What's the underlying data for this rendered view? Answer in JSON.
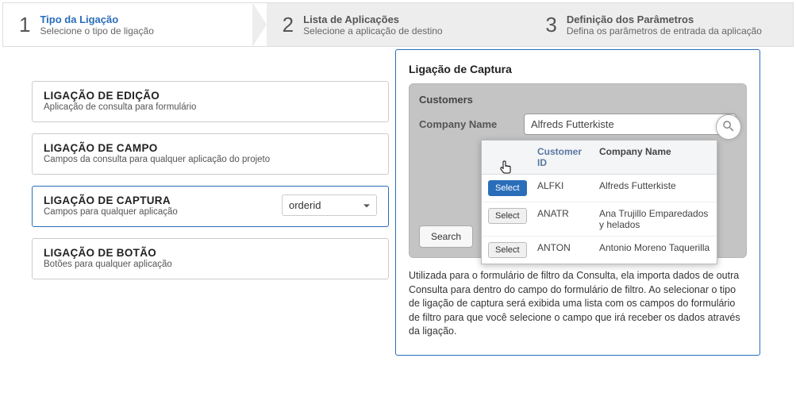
{
  "steps": [
    {
      "num": "1",
      "title": "Tipo da Ligação",
      "sub": "Selecione o tipo de ligação"
    },
    {
      "num": "2",
      "title": "Lista de Aplicações",
      "sub": "Selecione a aplicação de destino"
    },
    {
      "num": "3",
      "title": "Definição dos Parâmetros",
      "sub": "Defina os parâmetros de entrada da aplicação"
    }
  ],
  "link_types": [
    {
      "title": "LIGAÇÃO DE EDIÇÃO",
      "sub": "Aplicação de consulta para formulário"
    },
    {
      "title": "LIGAÇÃO DE CAMPO",
      "sub": "Campos da consulta para qualquer aplicação do projeto"
    },
    {
      "title": "LIGAÇÃO DE CAPTURA",
      "sub": "Campos para qualquer aplicação"
    },
    {
      "title": "LIGAÇÃO DE BOTÃO",
      "sub": "Botões para qualquer aplicação"
    }
  ],
  "selected_field": "orderid",
  "preview": {
    "title": "Ligação de Captura",
    "heading": "Customers",
    "field_label": "Company Name",
    "field_value": "Alfreds Futterkiste",
    "cols": {
      "sel": "",
      "id": "Customer ID",
      "name": "Company Name"
    },
    "select_label": "Select",
    "rows": [
      {
        "id": "ALFKI",
        "name": "Alfreds Futterkiste",
        "primary": true
      },
      {
        "id": "ANATR",
        "name": "Ana Trujillo Emparedados y helados",
        "primary": false
      },
      {
        "id": "ANTON",
        "name": "Antonio Moreno Taquerilla",
        "primary": false
      }
    ],
    "search_label": "Search",
    "desc": "Utilizada para o formulário de filtro da Consulta, ela importa dados de outra Consulta para dentro do campo do formulário de filtro. Ao selecionar o tipo de ligação de captura será exibida uma lista com os campos do formulário de filtro para que você selecione o campo que irá receber os dados através da ligação."
  }
}
